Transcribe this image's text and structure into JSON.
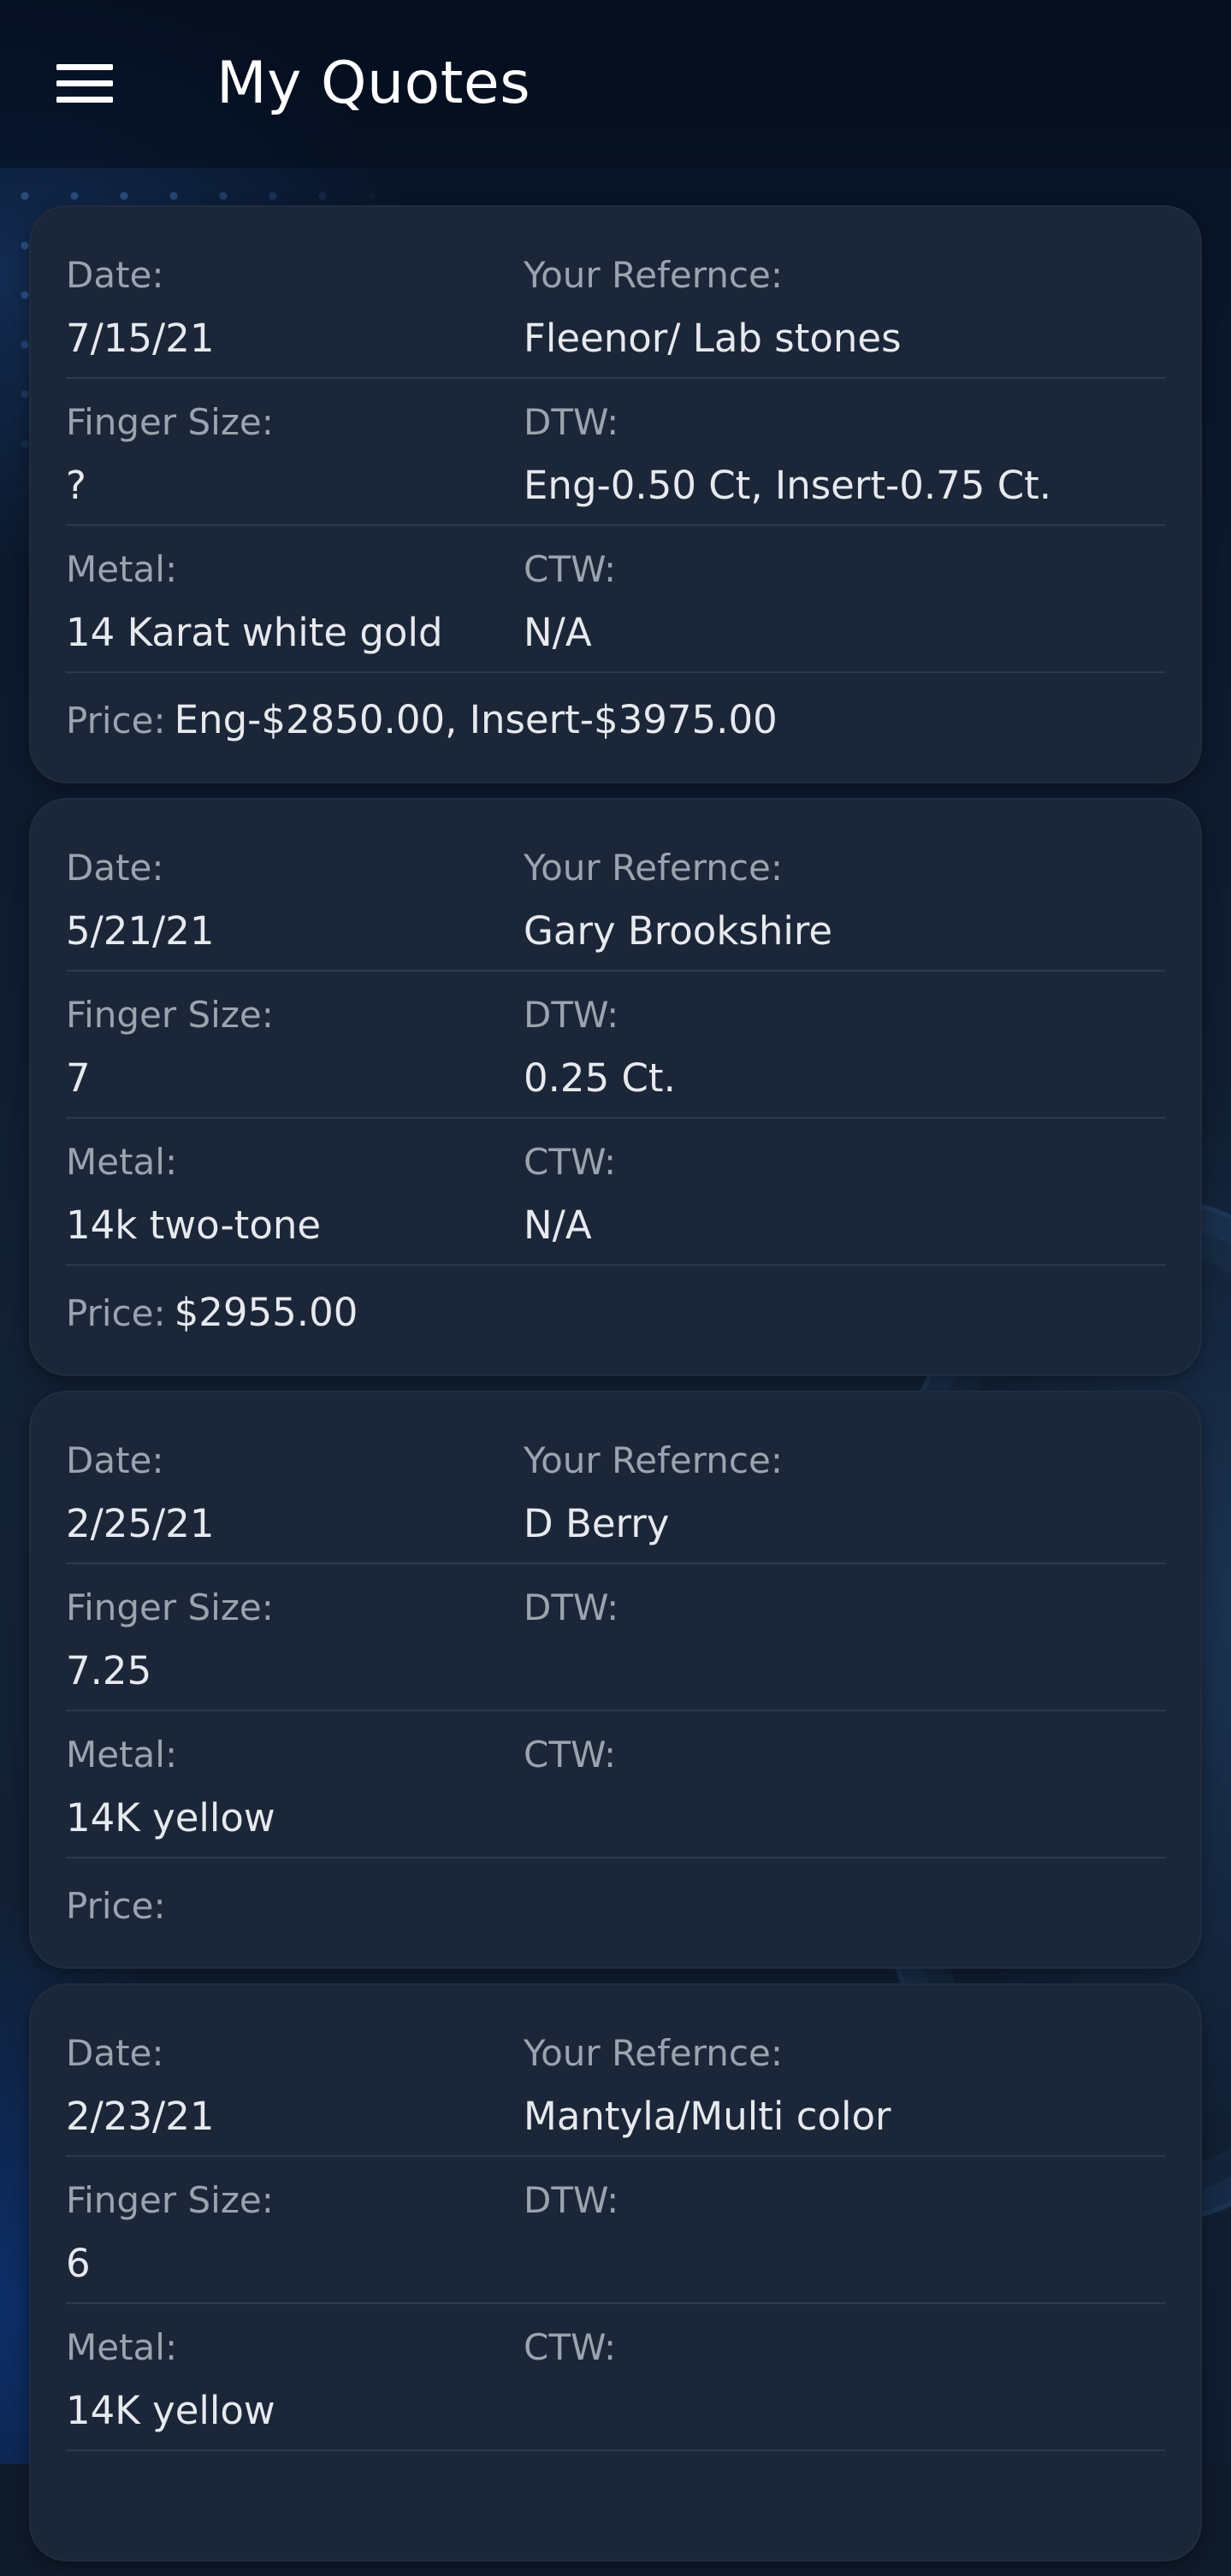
{
  "header": {
    "title": "My Quotes",
    "menu_icon": "menu-icon"
  },
  "labels": {
    "date": "Date:",
    "reference": "Your Refernce:",
    "finger_size": "Finger Size:",
    "dtw": "DTW:",
    "metal": "Metal:",
    "ctw": "CTW:",
    "price": "Price:"
  },
  "quotes": [
    {
      "date": "7/15/21",
      "reference": "Fleenor/ Lab stones",
      "finger_size": "?",
      "dtw": "Eng-0.50 Ct, Insert-0.75 Ct.",
      "metal": "14 Karat white gold",
      "ctw": "N/A",
      "price": "Eng-$2850.00, Insert-$3975.00"
    },
    {
      "date": "5/21/21",
      "reference": "Gary Brookshire",
      "finger_size": "7",
      "dtw": "0.25 Ct.",
      "metal": "14k two-tone",
      "ctw": "N/A",
      "price": "$2955.00"
    },
    {
      "date": "2/25/21",
      "reference": "D Berry",
      "finger_size": "7.25",
      "dtw": "",
      "metal": "14K yellow",
      "ctw": "",
      "price": ""
    },
    {
      "date": "2/23/21",
      "reference": "Mantyla/Multi color",
      "finger_size": "6",
      "dtw": "",
      "metal": "14K yellow",
      "ctw": "",
      "price": ""
    }
  ]
}
